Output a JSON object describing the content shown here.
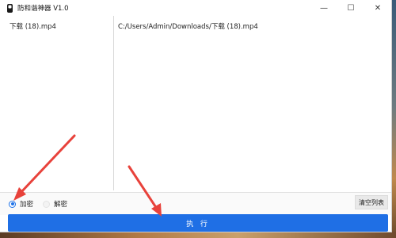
{
  "window": {
    "title": "防和谐神器 V1.0",
    "controls": {
      "minimize": "—",
      "maximize": "☐",
      "close": "✕"
    }
  },
  "files": {
    "left_item": "下载 (18).mp4",
    "right_path": "C:/Users/Admin/Downloads/下载 (18).mp4"
  },
  "options": {
    "encrypt_label": "加密",
    "decrypt_label": "解密",
    "selected": "加密"
  },
  "buttons": {
    "clear_list": "清空列表",
    "execute": "执 行"
  },
  "colors": {
    "accent": "#1f6fe5",
    "annotation_arrow": "#e8423b"
  }
}
